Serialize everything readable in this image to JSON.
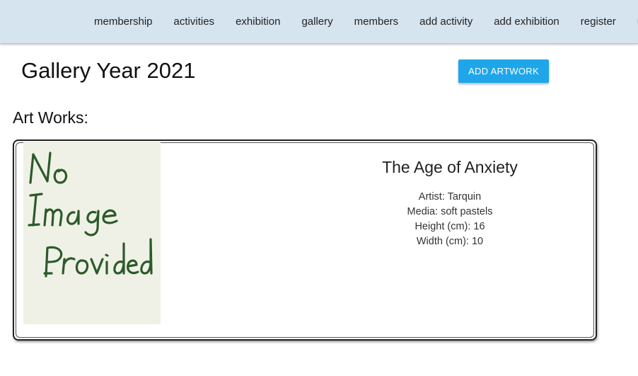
{
  "nav": {
    "items": [
      {
        "label": "membership"
      },
      {
        "label": "activities"
      },
      {
        "label": "exhibition"
      },
      {
        "label": "gallery"
      },
      {
        "label": "members"
      },
      {
        "label": "add activity"
      },
      {
        "label": "add exhibition"
      },
      {
        "label": "register"
      },
      {
        "label": "users"
      }
    ]
  },
  "page": {
    "title": "Gallery Year 2021",
    "add_button_label": "ADD ARTWORK",
    "section_heading": "Art Works:"
  },
  "artworks": [
    {
      "image_text_lines": [
        "No",
        "Image",
        "Provided"
      ],
      "title": "The Age of Anxiety",
      "artist": "Artist: Tarquin",
      "media": "Media: soft pastels",
      "height": "Height (cm): 16",
      "width": "Width (cm): 10"
    }
  ],
  "colors": {
    "nav_background": "#d6e4f0",
    "button_background": "#1fa6ea",
    "placeholder_ink": "#2c5a2a",
    "placeholder_paper": "#eff1e6"
  }
}
